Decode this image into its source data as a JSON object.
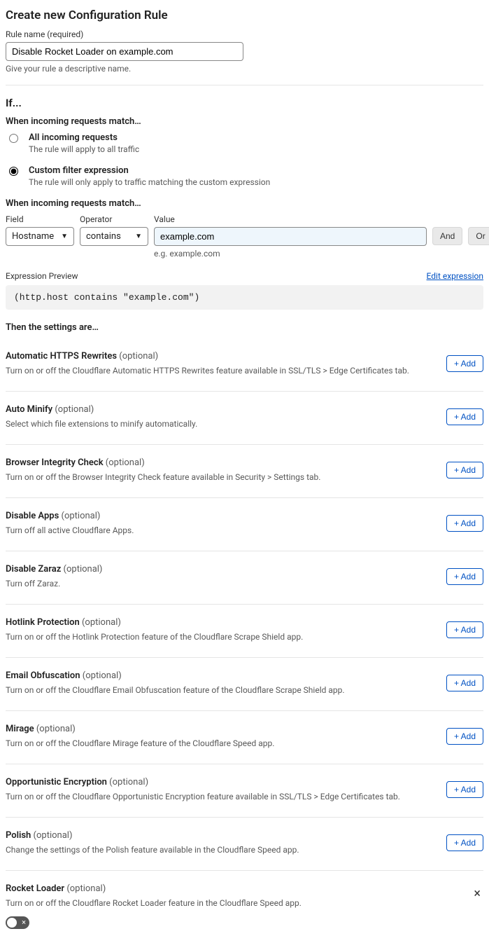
{
  "page_title": "Create new Configuration Rule",
  "rule_name": {
    "label": "Rule name (required)",
    "value": "Disable Rocket Loader on example.com",
    "hint": "Give your rule a descriptive name."
  },
  "if_heading": "If...",
  "match_label": "When incoming requests match…",
  "radio_all": {
    "title": "All incoming requests",
    "desc": "The rule will apply to all traffic"
  },
  "radio_custom": {
    "title": "Custom filter expression",
    "desc": "The rule will only apply to traffic matching the custom expression"
  },
  "match_label2": "When incoming requests match…",
  "filter": {
    "field_label": "Field",
    "field_value": "Hostname",
    "op_label": "Operator",
    "op_value": "contains",
    "value_label": "Value",
    "value_value": "example.com",
    "value_hint": "e.g. example.com",
    "and": "And",
    "or": "Or"
  },
  "expr": {
    "label": "Expression Preview",
    "edit": "Edit expression",
    "code": "(http.host contains \"example.com\")"
  },
  "then_heading": "Then the settings are…",
  "add_label": "+ Add",
  "optional_label": "(optional)",
  "settings": [
    {
      "title": "Automatic HTTPS Rewrites",
      "desc": "Turn on or off the Cloudflare Automatic HTTPS Rewrites feature available in SSL/TLS > Edge Certificates tab.",
      "action": "add"
    },
    {
      "title": "Auto Minify",
      "desc": "Select which file extensions to minify automatically.",
      "action": "add"
    },
    {
      "title": "Browser Integrity Check",
      "desc": "Turn on or off the Browser Integrity Check feature available in Security > Settings tab.",
      "action": "add"
    },
    {
      "title": "Disable Apps",
      "desc": "Turn off all active Cloudflare Apps.",
      "action": "add"
    },
    {
      "title": "Disable Zaraz",
      "desc": "Turn off Zaraz.",
      "action": "add"
    },
    {
      "title": "Hotlink Protection",
      "desc": "Turn on or off the Hotlink Protection feature of the Cloudflare Scrape Shield app.",
      "action": "add"
    },
    {
      "title": "Email Obfuscation",
      "desc": "Turn on or off the Cloudflare Email Obfuscation feature of the Cloudflare Scrape Shield app.",
      "action": "add"
    },
    {
      "title": "Mirage",
      "desc": "Turn on or off the Cloudflare Mirage feature of the Cloudflare Speed app.",
      "action": "add"
    },
    {
      "title": "Opportunistic Encryption",
      "desc": "Turn on or off the Cloudflare Opportunistic Encryption feature available in SSL/TLS > Edge Certificates tab.",
      "action": "add"
    },
    {
      "title": "Polish",
      "desc": "Change the settings of the Polish feature available in the Cloudflare Speed app.",
      "action": "add"
    },
    {
      "title": "Rocket Loader",
      "desc": "Turn on or off the Cloudflare Rocket Loader feature in the Cloudflare Speed app.",
      "action": "close"
    }
  ]
}
